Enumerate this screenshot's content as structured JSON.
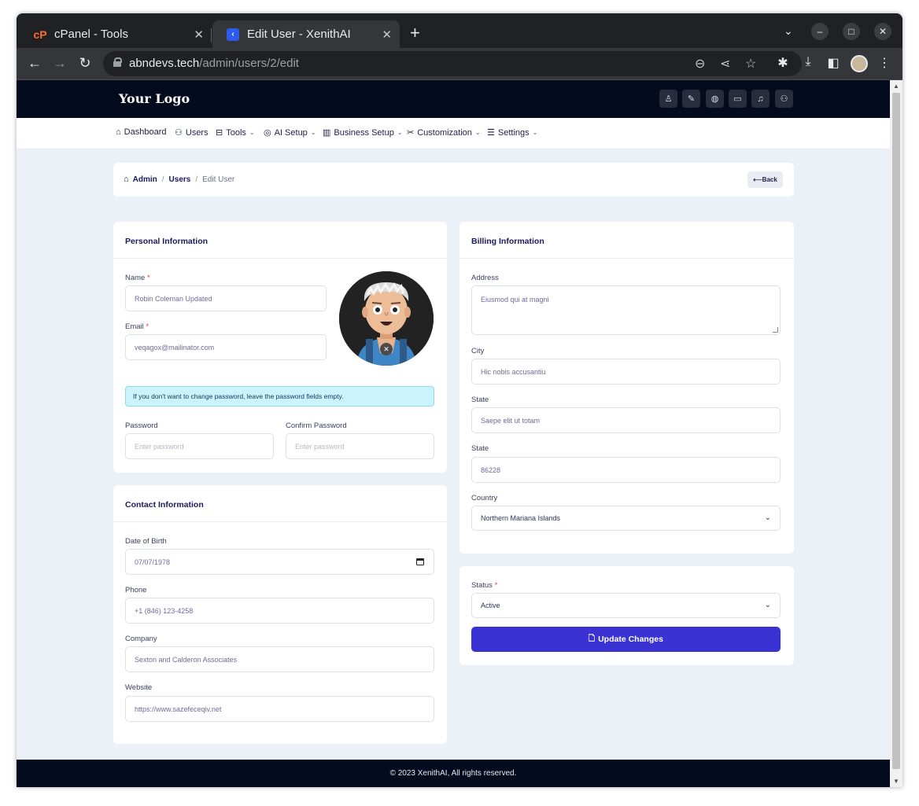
{
  "browser": {
    "tabs": [
      {
        "label": "cPanel - Tools",
        "favicon": "cP",
        "active": false
      },
      {
        "label": "Edit User - XenithAI",
        "favicon": "‹",
        "active": true
      }
    ],
    "url_host": "abndevs.tech",
    "url_path": "/admin/users/2/edit"
  },
  "header": {
    "logo": "Your Logo",
    "icons": [
      "user-icon",
      "paint-icon",
      "globe-icon",
      "card-icon",
      "bell-icon",
      "account-icon"
    ]
  },
  "nav": {
    "items": [
      {
        "label": "Dashboard",
        "icon": "home-icon",
        "dropdown": false
      },
      {
        "label": "Users",
        "icon": "users-icon",
        "dropdown": false
      },
      {
        "label": "Tools",
        "icon": "briefcase-icon",
        "dropdown": true
      },
      {
        "label": "AI Setup",
        "icon": "ai-icon",
        "dropdown": true
      },
      {
        "label": "Business Setup",
        "icon": "building-icon",
        "dropdown": true
      },
      {
        "label": "Customization",
        "icon": "tools-icon",
        "dropdown": true
      },
      {
        "label": "Settings",
        "icon": "sliders-icon",
        "dropdown": true
      }
    ]
  },
  "breadcrumb": {
    "items": [
      "Admin",
      "Users",
      "Edit User"
    ],
    "back": "Back"
  },
  "personal": {
    "title": "Personal Information",
    "name_label": "Name",
    "name_value": "Robin Coleman Updated",
    "email_label": "Email",
    "email_value": "veqagox@mailinator.com",
    "alert": "If you don't want to change password, leave the password fields empty.",
    "password_label": "Password",
    "password_placeholder": "Enter password",
    "confirm_label": "Confirm Password",
    "confirm_placeholder": "Enter password",
    "required_mark": "*"
  },
  "contact": {
    "title": "Contact Information",
    "dob_label": "Date of Birth",
    "dob_value": "07/07/1978",
    "phone_label": "Phone",
    "phone_value": "+1 (846) 123-4258",
    "company_label": "Company",
    "company_value": "Sexton and Calderon Associates",
    "website_label": "Website",
    "website_value": "https://www.sazefeceqiv.net"
  },
  "billing": {
    "title": "Billing Information",
    "address_label": "Address",
    "address_value": "Eiusmod qui at magni",
    "city_label": "City",
    "city_value": "Hic nobis accusantiu",
    "state_label": "State",
    "state_value": "Saepe elit ut totam",
    "zip_label": "State",
    "zip_value": "86228",
    "country_label": "Country",
    "country_value": "Northern Mariana Islands"
  },
  "status": {
    "label": "Status",
    "value": "Active",
    "submit": "Update Changes"
  },
  "footer": {
    "text": "© 2023 XenithAI, All rights reserved."
  },
  "colors": {
    "header_bg": "#050b1e",
    "primary": "#3a32d3",
    "page_bg": "#ecf1f8",
    "alert_bg": "#cbf3fb",
    "required": "#e53950"
  }
}
